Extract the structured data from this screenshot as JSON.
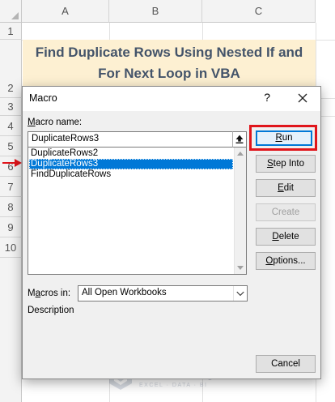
{
  "sheet": {
    "columns": [
      "A",
      "B",
      "C"
    ],
    "rows": [
      "1",
      "2",
      "3",
      "4",
      "5",
      "6",
      "7",
      "8",
      "9",
      "10"
    ],
    "title_line1": "Find Duplicate Rows Using Nested If and",
    "title_line2": "For Next Loop in VBA"
  },
  "dialog": {
    "title": "Macro",
    "help_label": "?",
    "macro_name_label_key": "M",
    "macro_name_label_rest": "acro name:",
    "macro_name_value": "DuplicateRows3",
    "macros": [
      "DuplicateRows2",
      "DuplicateRows3",
      "FindDuplicateRows"
    ],
    "selected_macro": "DuplicateRows3",
    "macros_in_label_pre": "M",
    "macros_in_label_key": "a",
    "macros_in_label_rest": "cros in:",
    "macros_in_value": "All Open Workbooks",
    "description_label": "Description",
    "buttons": {
      "run_key": "R",
      "run_rest": "un",
      "step_into_key": "S",
      "step_into_rest": "tep Into",
      "edit_key": "E",
      "edit_rest": "dit",
      "create": "Create",
      "delete_key": "D",
      "delete_rest": "elete",
      "options_key": "O",
      "options_rest": "ptions...",
      "cancel": "Cancel"
    }
  },
  "watermark": {
    "name": "exceldemy",
    "tagline": "EXCEL · DATA · BI"
  },
  "colors": {
    "highlight_box": "#e0151b",
    "selection": "#0078d7",
    "title_band": "#fdf0d2",
    "title_text": "#44546a"
  }
}
